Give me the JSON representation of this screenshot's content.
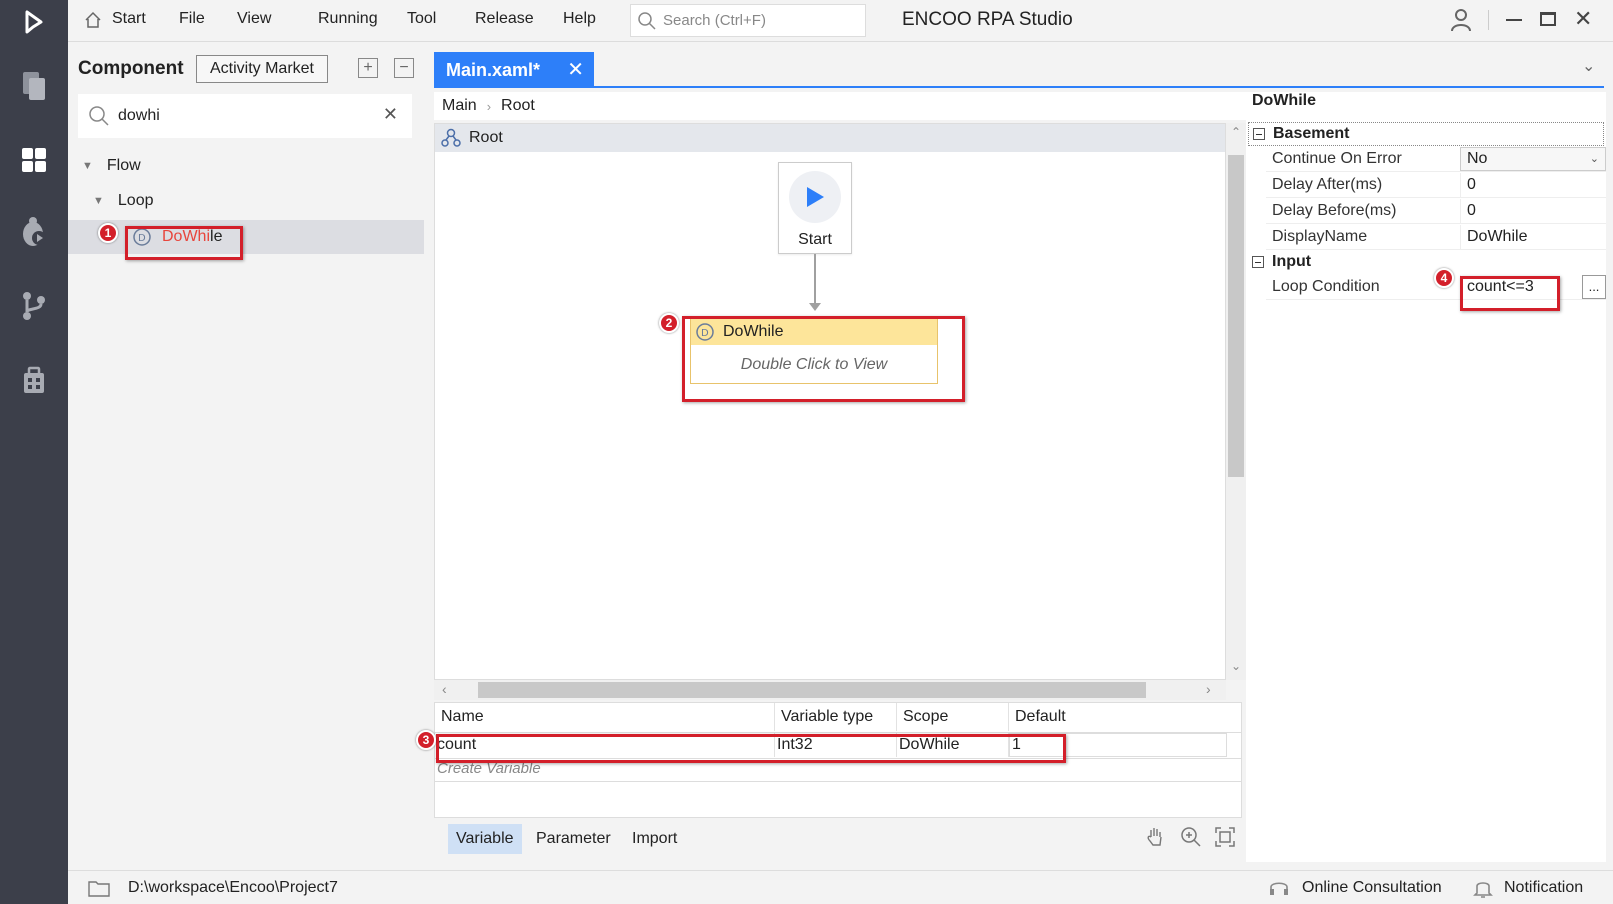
{
  "app": {
    "title": "ENCOO RPA Studio"
  },
  "menu": [
    "Start",
    "File",
    "View",
    "Running",
    "Tool",
    "Release",
    "Help"
  ],
  "search": {
    "placeholder": "Search (Ctrl+F)"
  },
  "component_panel": {
    "title": "Component",
    "market_button": "Activity Market",
    "search_value": "dowhi",
    "tree": {
      "flow": "Flow",
      "loop": "Loop",
      "match_highlight": "DoWhi",
      "match_rest": "le"
    }
  },
  "editor": {
    "tab_label": "Main.xaml*",
    "breadcrumb": [
      "Main",
      "Root"
    ],
    "root_label": "Root",
    "start_label": "Start",
    "activity": {
      "title": "DoWhile",
      "hint": "Double Click to View"
    }
  },
  "variables": {
    "columns": [
      "Name",
      "Variable type",
      "Scope",
      "Default"
    ],
    "rows": [
      {
        "name": "count",
        "type": "Int32",
        "scope": "DoWhile",
        "default": "1"
      }
    ],
    "create_label": "Create Variable",
    "tabs": [
      "Variable",
      "Parameter",
      "Import"
    ]
  },
  "properties": {
    "title": "DoWhile",
    "groups": {
      "basement": "Basement",
      "input": "Input"
    },
    "basement_rows": [
      {
        "name": "Continue On Error",
        "value": "No"
      },
      {
        "name": "Delay After(ms)",
        "value": "0"
      },
      {
        "name": "Delay Before(ms)",
        "value": "0"
      },
      {
        "name": "DisplayName",
        "value": "DoWhile"
      }
    ],
    "input_rows": [
      {
        "name": "Loop Condition",
        "value": "count<=3"
      }
    ],
    "ellipsis": "..."
  },
  "statusbar": {
    "path": "D:\\workspace\\Encoo\\Project7",
    "consult": "Online Consultation",
    "notify": "Notification"
  },
  "annotations": [
    "1",
    "2",
    "3",
    "4"
  ],
  "colors": {
    "accent": "#2d7ff9",
    "rail": "#3c3f4a",
    "annotation": "#d31f2a",
    "activity_head": "#fde59a"
  }
}
